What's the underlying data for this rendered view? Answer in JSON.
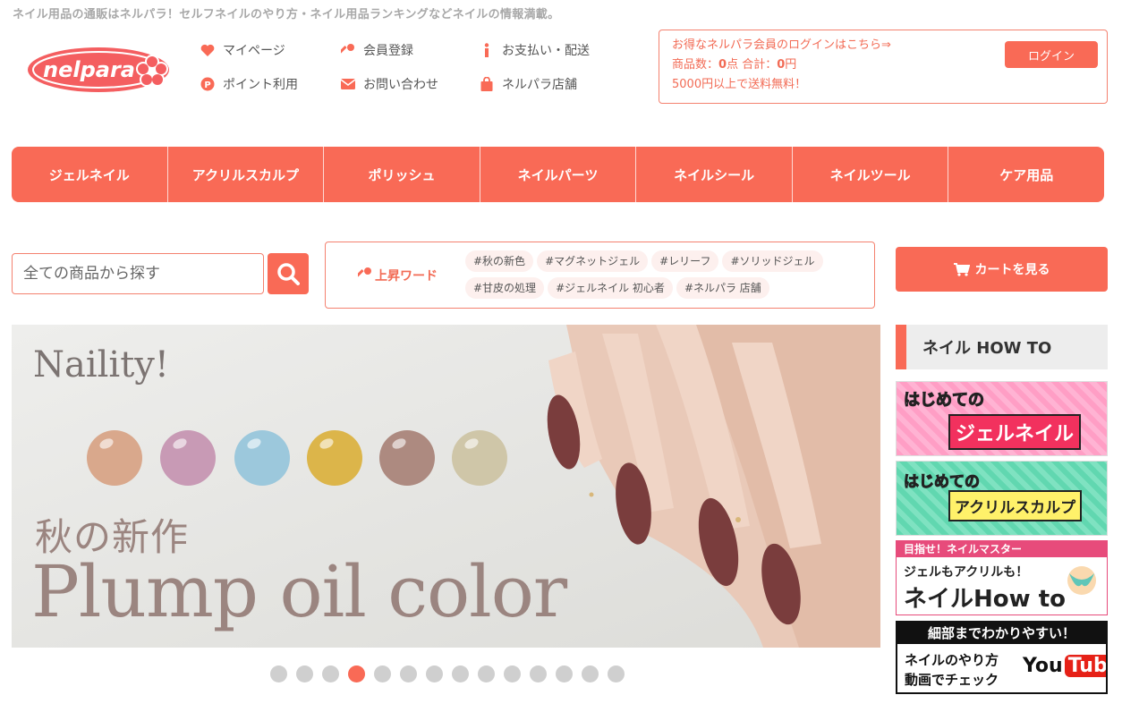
{
  "header": {
    "tagline": "ネイル用品の通販はネルパラ！セルフネイルのやり方・ネイル用品ランキングなどネイルの情報満載。",
    "logo_text": "nelpara"
  },
  "quicklinks": [
    {
      "label": "マイページ",
      "icon": "heart-icon"
    },
    {
      "label": "会員登録",
      "icon": "key-icon"
    },
    {
      "label": "お支払い・配送",
      "icon": "info-icon"
    },
    {
      "label": "ポイント利用",
      "icon": "point-icon"
    },
    {
      "label": "お問い合わせ",
      "icon": "mail-icon"
    },
    {
      "label": "ネルパラ店舗",
      "icon": "shopping-bag-icon"
    }
  ],
  "login_box": {
    "prompt": "お得なネルパラ会員のログインはこちら⇒",
    "items_label": "商品数：",
    "items_count": "0",
    "items_unit": "点",
    "total_label": "合計：",
    "total_value": "0",
    "total_unit": "円",
    "shipping_note": "5000円以上で送料無料！",
    "login_button": "ログイン"
  },
  "nav": [
    "ジェルネイル",
    "アクリルスカルプ",
    "ポリッシュ",
    "ネイルパーツ",
    "ネイルシール",
    "ネイルツール",
    "ケア用品"
  ],
  "search": {
    "placeholder": "全ての商品から探す"
  },
  "trending": {
    "label": "上昇ワード",
    "tags": [
      "#秋の新色",
      "#マグネットジェル",
      "#レリーフ",
      "#ソリッドジェル",
      "#甘皮の処理",
      "#ジェルネイル 初心者",
      "#ネルパラ 店舗"
    ]
  },
  "cart_button": "カートを見る",
  "banner": {
    "brand": "Naility!",
    "subtitle": "秋の新作",
    "headline": "Plump oil color",
    "swatch_colors": [
      "#d9a88c",
      "#c89ab5",
      "#9cc8dc",
      "#dcb54a",
      "#ad8a80",
      "#cfc6a8"
    ]
  },
  "carousel": {
    "dot_count": 14,
    "active_index": 3
  },
  "howto": {
    "heading": "ネイル HOW TO",
    "banners": [
      {
        "line1": "はじめての",
        "line2": "ジェルネイル"
      },
      {
        "line1": "はじめての",
        "line2": "アクリルスカルプ"
      },
      {
        "line1": "目指せ！ネイルマスター",
        "line2": "ジェルもアクリルも！",
        "line3": "ネイルHow to"
      },
      {
        "line1": "細部までわかりやすい！",
        "line2": "ネイルのやり方",
        "line3": "動画でチェック",
        "badge": "YouTube"
      }
    ]
  },
  "colors": {
    "accent": "#f96a56",
    "accent_text": "#f26b55"
  }
}
